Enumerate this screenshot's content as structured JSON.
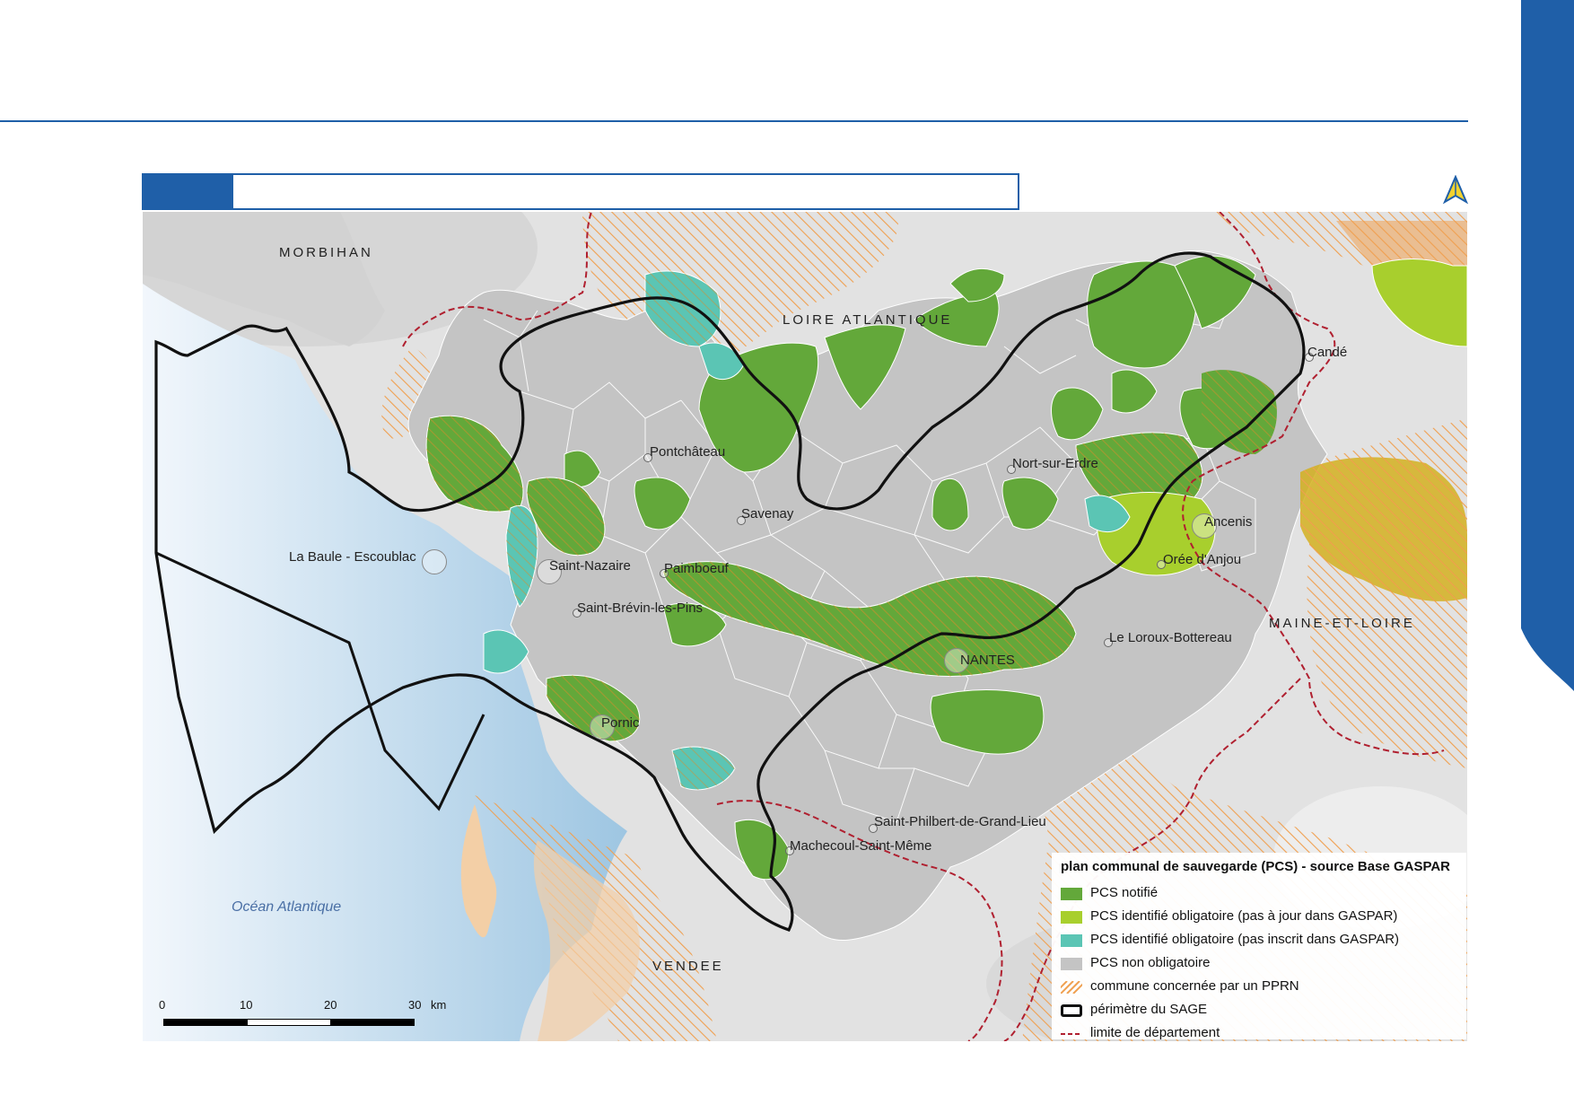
{
  "header": {
    "title": ""
  },
  "colors": {
    "brand_blue": "#1f5fa8",
    "pcs_notifie": "#63a83a",
    "pcs_obligatoire_pas_a_jour": "#a8cf2d",
    "pcs_obligatoire_pas_inscrit": "#5bc5b4",
    "pcs_non_obligatoire": "#c4c4c4",
    "pprn_hatch": "#f0a050",
    "sage_perimeter": "#111111",
    "department_limit": "#b02030",
    "ocean": "#a8cde6"
  },
  "map": {
    "departments": [
      "MORBIHAN",
      "LOIRE ATLANTIQUE",
      "MAINE-ET-LOIRE",
      "VENDEE"
    ],
    "ocean_label": "Océan Atlantique",
    "places": [
      "Candé",
      "Pontchâteau",
      "Nort-sur-Erdre",
      "Savenay",
      "Ancenis",
      "La Baule - Escoublac",
      "Saint-Nazaire",
      "Paimboeuf",
      "Orée d'Anjou",
      "Saint-Brévin-les-Pins",
      "Le Loroux-Bottereau",
      "NANTES",
      "Pornic",
      "Saint-Philbert-de-Grand-Lieu",
      "Machecoul-Saint-Même"
    ]
  },
  "legend": {
    "title": "plan communal de sauvegarde (PCS) - source Base GASPAR",
    "items": [
      {
        "label": "PCS notifié",
        "icon": "solid-swatch-dark-green"
      },
      {
        "label": "PCS identifié obligatoire (pas à jour dans GASPAR)",
        "icon": "solid-swatch-light-green"
      },
      {
        "label": "PCS identifié obligatoire (pas inscrit dans GASPAR)",
        "icon": "solid-swatch-teal"
      },
      {
        "label": "PCS non obligatoire",
        "icon": "solid-swatch-grey"
      },
      {
        "label": "commune concernée par un PPRN",
        "icon": "hatch-swatch-orange"
      },
      {
        "label": "périmètre du SAGE",
        "icon": "outline-swatch-black"
      },
      {
        "label": "limite de département",
        "icon": "dashed-line-red"
      }
    ]
  },
  "scale": {
    "ticks": [
      "0",
      "10",
      "20",
      "30"
    ],
    "unit": "km"
  }
}
